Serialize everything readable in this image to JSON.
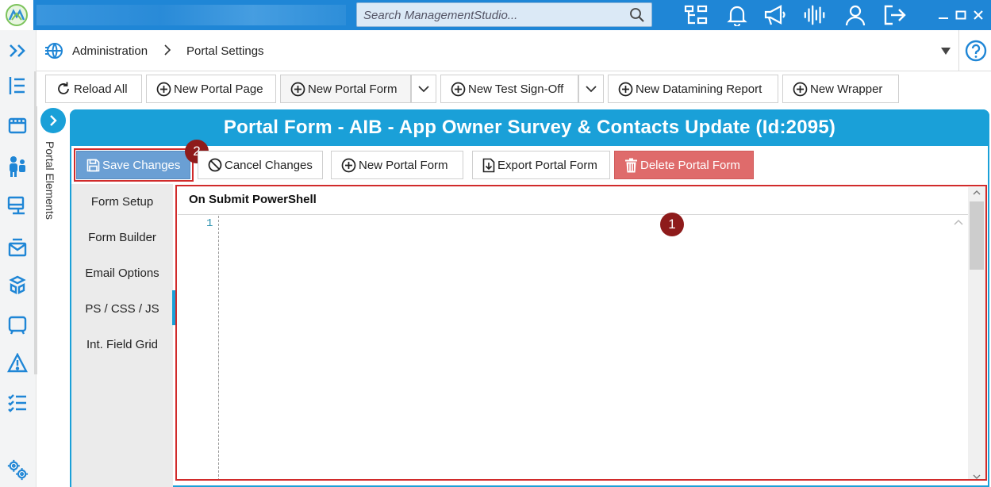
{
  "titlebar": {
    "search_placeholder": "Search ManagementStudio...",
    "icons": [
      "org-chart-icon",
      "bell-icon",
      "megaphone-icon",
      "audio-wave-icon",
      "user-icon",
      "logout-icon"
    ],
    "window_controls": [
      "minimize-icon",
      "maximize-icon",
      "close-icon"
    ]
  },
  "breadcrumb": {
    "items": [
      "Administration",
      "Portal Settings"
    ]
  },
  "toolbar": {
    "reload_all": "Reload All",
    "new_portal_page": "New Portal Page",
    "new_portal_form": "New Portal Form",
    "new_test_signoff": "New Test Sign-Off",
    "new_datamining_report": "New Datamining Report",
    "new_wrapper": "New Wrapper"
  },
  "portal_elements": {
    "label": "Portal Elements"
  },
  "panel": {
    "title": "Portal Form -  AIB - App Owner Survey & Contacts Update  (Id:2095)",
    "save_changes": "Save Changes",
    "cancel_changes": "Cancel Changes",
    "new_portal_form": "New Portal Form",
    "export_portal_form": "Export Portal Form",
    "delete_portal_form": "Delete Portal Form"
  },
  "sidenav": {
    "items": [
      "Form Setup",
      "Form Builder",
      "Email Options",
      "PS / CSS / JS",
      "Int. Field Grid"
    ],
    "active": "PS / CSS / JS"
  },
  "editor": {
    "title": "On Submit PowerShell",
    "line_numbers": [
      "1"
    ]
  },
  "markers": {
    "m1": "1",
    "m2": "2"
  },
  "colors": {
    "titlebar": "#1f86d6",
    "accent": "#1aa0d8",
    "save": "#6a9fd4",
    "delete": "#df6b6b",
    "highlight": "#d12b2b",
    "marker": "#8e1b1b"
  }
}
